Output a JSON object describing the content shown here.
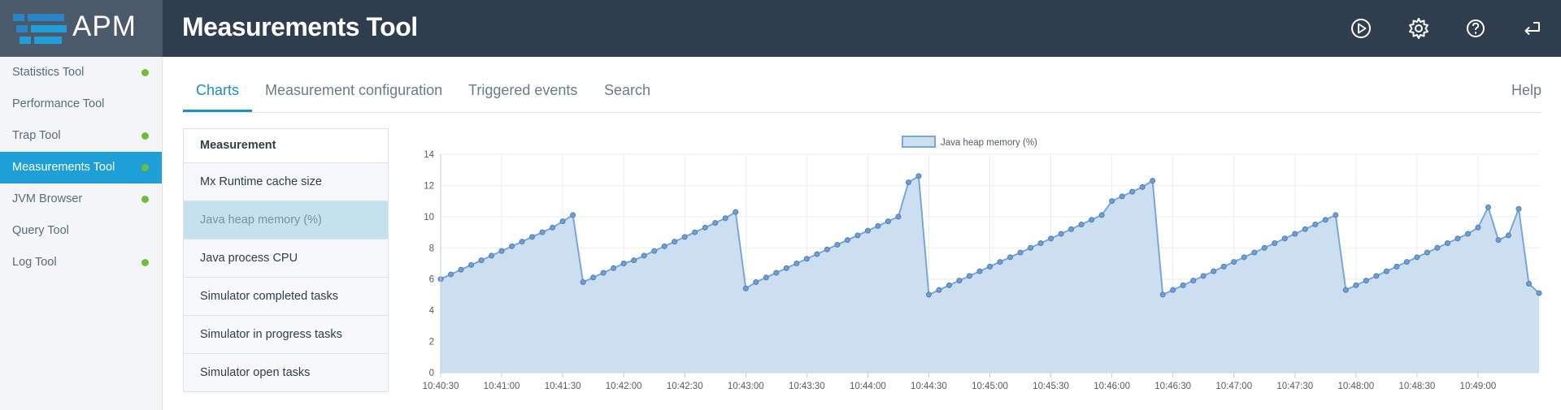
{
  "app": {
    "brand": "APM",
    "title": "Measurements Tool",
    "icons": [
      "play-circle-icon",
      "gear-icon",
      "help-circle-icon",
      "logout-arrow-icon"
    ]
  },
  "sidebar": {
    "items": [
      {
        "label": "Statistics Tool",
        "dot": true
      },
      {
        "label": "Performance Tool",
        "dot": false
      },
      {
        "label": "Trap Tool",
        "dot": true
      },
      {
        "label": "Measurements Tool",
        "dot": true,
        "active": true
      },
      {
        "label": "JVM Browser",
        "dot": true
      },
      {
        "label": "Query Tool",
        "dot": false
      },
      {
        "label": "Log Tool",
        "dot": true
      }
    ],
    "dot_color": "#6fbe3b",
    "active_color": "#1ea0d6"
  },
  "tabs": {
    "items": [
      "Charts",
      "Measurement configuration",
      "Triggered events",
      "Search"
    ],
    "active": "Charts",
    "help": "Help"
  },
  "measurements": {
    "header": "Measurement",
    "items": [
      "Mx Runtime cache size",
      "Java heap memory (%)",
      "Java process CPU",
      "Simulator completed tasks",
      "Simulator in progress tasks",
      "Simulator open tasks"
    ],
    "selected": "Java heap memory (%)"
  },
  "chart_data": {
    "type": "area",
    "legend": "Java heap memory (%)",
    "legend_position": "top-center",
    "series": [
      {
        "name": "Java heap memory (%)",
        "color": "#7aa7d6",
        "fill": "#ccdff0",
        "points": [
          [
            "10:40:30",
            6.0
          ],
          [
            "10:40:35",
            6.3
          ],
          [
            "10:40:40",
            6.6
          ],
          [
            "10:40:45",
            6.9
          ],
          [
            "10:40:50",
            7.2
          ],
          [
            "10:40:55",
            7.5
          ],
          [
            "10:41:00",
            7.8
          ],
          [
            "10:41:05",
            8.1
          ],
          [
            "10:41:10",
            8.4
          ],
          [
            "10:41:15",
            8.7
          ],
          [
            "10:41:20",
            9.0
          ],
          [
            "10:41:25",
            9.3
          ],
          [
            "10:41:30",
            9.7
          ],
          [
            "10:41:35",
            10.1
          ],
          [
            "10:41:40",
            5.8
          ],
          [
            "10:41:45",
            6.1
          ],
          [
            "10:41:50",
            6.4
          ],
          [
            "10:41:55",
            6.7
          ],
          [
            "10:42:00",
            7.0
          ],
          [
            "10:42:05",
            7.2
          ],
          [
            "10:42:10",
            7.5
          ],
          [
            "10:42:15",
            7.8
          ],
          [
            "10:42:20",
            8.1
          ],
          [
            "10:42:25",
            8.4
          ],
          [
            "10:42:30",
            8.7
          ],
          [
            "10:42:35",
            9.0
          ],
          [
            "10:42:40",
            9.3
          ],
          [
            "10:42:45",
            9.6
          ],
          [
            "10:42:50",
            9.9
          ],
          [
            "10:42:55",
            10.3
          ],
          [
            "10:43:00",
            5.4
          ],
          [
            "10:43:05",
            5.8
          ],
          [
            "10:43:10",
            6.1
          ],
          [
            "10:43:15",
            6.4
          ],
          [
            "10:43:20",
            6.7
          ],
          [
            "10:43:25",
            7.0
          ],
          [
            "10:43:30",
            7.3
          ],
          [
            "10:43:35",
            7.6
          ],
          [
            "10:43:40",
            7.9
          ],
          [
            "10:43:45",
            8.2
          ],
          [
            "10:43:50",
            8.5
          ],
          [
            "10:43:55",
            8.8
          ],
          [
            "10:44:00",
            9.1
          ],
          [
            "10:44:05",
            9.4
          ],
          [
            "10:44:10",
            9.7
          ],
          [
            "10:44:15",
            10.0
          ],
          [
            "10:44:20",
            12.2
          ],
          [
            "10:44:25",
            12.6
          ],
          [
            "10:44:30",
            5.0
          ],
          [
            "10:44:35",
            5.3
          ],
          [
            "10:44:40",
            5.6
          ],
          [
            "10:44:45",
            5.9
          ],
          [
            "10:44:50",
            6.2
          ],
          [
            "10:44:55",
            6.5
          ],
          [
            "10:45:00",
            6.8
          ],
          [
            "10:45:05",
            7.1
          ],
          [
            "10:45:10",
            7.4
          ],
          [
            "10:45:15",
            7.7
          ],
          [
            "10:45:20",
            8.0
          ],
          [
            "10:45:25",
            8.3
          ],
          [
            "10:45:30",
            8.6
          ],
          [
            "10:45:35",
            8.9
          ],
          [
            "10:45:40",
            9.2
          ],
          [
            "10:45:45",
            9.5
          ],
          [
            "10:45:50",
            9.8
          ],
          [
            "10:45:55",
            10.1
          ],
          [
            "10:46:00",
            11.0
          ],
          [
            "10:46:05",
            11.3
          ],
          [
            "10:46:10",
            11.6
          ],
          [
            "10:46:15",
            11.9
          ],
          [
            "10:46:20",
            12.3
          ],
          [
            "10:46:25",
            5.0
          ],
          [
            "10:46:30",
            5.3
          ],
          [
            "10:46:35",
            5.6
          ],
          [
            "10:46:40",
            5.9
          ],
          [
            "10:46:45",
            6.2
          ],
          [
            "10:46:50",
            6.5
          ],
          [
            "10:46:55",
            6.8
          ],
          [
            "10:47:00",
            7.1
          ],
          [
            "10:47:05",
            7.4
          ],
          [
            "10:47:10",
            7.7
          ],
          [
            "10:47:15",
            8.0
          ],
          [
            "10:47:20",
            8.3
          ],
          [
            "10:47:25",
            8.6
          ],
          [
            "10:47:30",
            8.9
          ],
          [
            "10:47:35",
            9.2
          ],
          [
            "10:47:40",
            9.5
          ],
          [
            "10:47:45",
            9.8
          ],
          [
            "10:47:50",
            10.1
          ],
          [
            "10:47:55",
            5.3
          ],
          [
            "10:48:00",
            5.6
          ],
          [
            "10:48:05",
            5.9
          ],
          [
            "10:48:10",
            6.2
          ],
          [
            "10:48:15",
            6.5
          ],
          [
            "10:48:20",
            6.8
          ],
          [
            "10:48:25",
            7.1
          ],
          [
            "10:48:30",
            7.4
          ],
          [
            "10:48:35",
            7.7
          ],
          [
            "10:48:40",
            8.0
          ],
          [
            "10:48:45",
            8.3
          ],
          [
            "10:48:50",
            8.6
          ],
          [
            "10:48:55",
            8.9
          ],
          [
            "10:49:00",
            9.3
          ],
          [
            "10:49:05",
            10.6
          ],
          [
            "10:49:10",
            8.5
          ],
          [
            "10:49:15",
            8.8
          ],
          [
            "10:49:20",
            10.5
          ],
          [
            "10:49:25",
            5.7
          ],
          [
            "10:49:30",
            5.1
          ]
        ]
      }
    ],
    "x_ticks": [
      "10:40:30",
      "10:41:00",
      "10:41:30",
      "10:42:00",
      "10:42:30",
      "10:43:00",
      "10:43:30",
      "10:44:00",
      "10:44:30",
      "10:45:00",
      "10:45:30",
      "10:46:00",
      "10:46:30",
      "10:47:00",
      "10:47:30",
      "10:48:00",
      "10:48:30",
      "10:49:00"
    ],
    "ylim": [
      0,
      14
    ],
    "y_ticks": [
      0,
      2,
      4,
      6,
      8,
      10,
      12,
      14
    ],
    "grid": true
  }
}
